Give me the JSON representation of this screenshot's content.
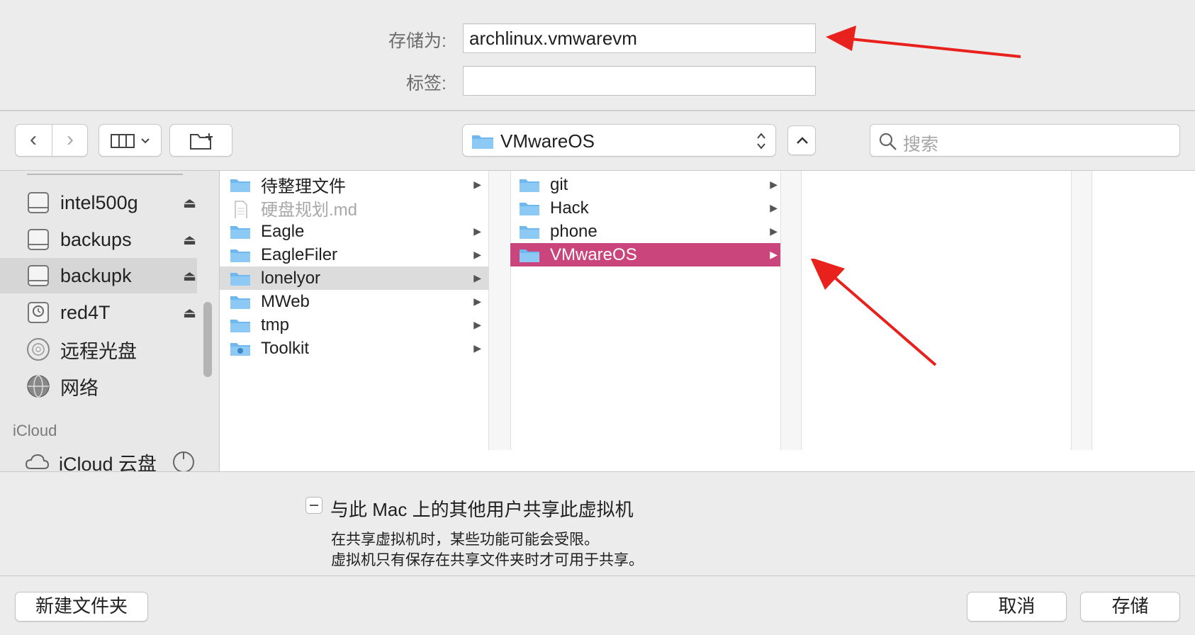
{
  "form": {
    "save_as_label": "存储为:",
    "save_as_value": "archlinux.vmwarevm",
    "tags_label": "标签:",
    "tags_value": ""
  },
  "toolbar": {
    "path_selected": "VMwareOS",
    "search_placeholder": "搜索"
  },
  "sidebar": {
    "items": [
      {
        "label": "intel500g",
        "icon": "drive-icon",
        "eject": "⏏"
      },
      {
        "label": "backups",
        "icon": "drive-icon",
        "eject": "⏏"
      },
      {
        "label": "backupk",
        "icon": "drive-icon",
        "eject": "⏏",
        "selected": true
      },
      {
        "label": "red4T",
        "icon": "time-machine-drive-icon",
        "eject": "⏏"
      },
      {
        "label": "远程光盘",
        "icon": "disc-icon"
      },
      {
        "label": "网络",
        "icon": "network-icon"
      }
    ],
    "icloud_section": "iCloud",
    "icloud_item": "iCloud 云盘"
  },
  "columns": {
    "col1": [
      {
        "label": "待整理文件",
        "type": "folder",
        "arrow": "▶"
      },
      {
        "label": "硬盘规划.md",
        "type": "file",
        "dimmed": true
      },
      {
        "label": "Eagle",
        "type": "folder",
        "arrow": "▶"
      },
      {
        "label": "EagleFiler",
        "type": "folder",
        "arrow": "▶"
      },
      {
        "label": "lonelyor",
        "type": "folder",
        "arrow": "▶",
        "state": "parent"
      },
      {
        "label": "MWeb",
        "type": "folder",
        "arrow": "▶"
      },
      {
        "label": "tmp",
        "type": "folder",
        "arrow": "▶"
      },
      {
        "label": "Toolkit",
        "type": "app-folder",
        "arrow": "▶"
      }
    ],
    "col2": [
      {
        "label": "git",
        "type": "folder",
        "arrow": "▶"
      },
      {
        "label": "Hack",
        "type": "folder",
        "arrow": "▶"
      },
      {
        "label": "phone",
        "type": "folder",
        "arrow": "▶"
      },
      {
        "label": "VMwareOS",
        "type": "folder",
        "arrow": "▶",
        "state": "selected"
      }
    ]
  },
  "options": {
    "share_checkbox_label": "与此 Mac 上的其他用户共享此虚拟机",
    "share_note_line1": "在共享虚拟机时，某些功能可能会受限。",
    "share_note_line2": "虚拟机只有保存在共享文件夹时才可用于共享。"
  },
  "buttons": {
    "new_folder": "新建文件夹",
    "cancel": "取消",
    "save": "存储"
  },
  "colors": {
    "selection": "#c9457b",
    "annotation_arrow": "#e8211d",
    "folder": "#6fb8ef"
  }
}
